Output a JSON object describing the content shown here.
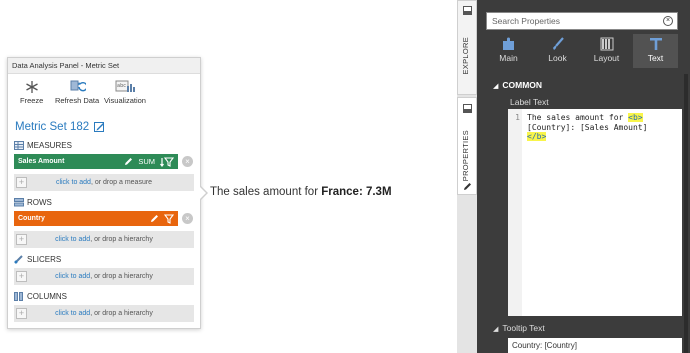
{
  "dap": {
    "title": "Data Analysis Panel - Metric Set",
    "toolbar": {
      "freeze": "Freeze",
      "refresh": "Refresh Data",
      "visualization": "Visualization"
    },
    "metric_set_title": "Metric Set 182",
    "sections": {
      "measures": "MEASURES",
      "rows": "ROWS",
      "slicers": "SLICERS",
      "columns": "COLUMNS"
    },
    "measure_field": {
      "label": "Sales Amount",
      "aggregation": "SUM",
      "color": "#2e8b57"
    },
    "row_field": {
      "label": "Country",
      "color": "#e8650e"
    },
    "drop": {
      "click_to_add": "click to add",
      "measure_rest": ", or drop a measure",
      "hierarchy_rest": ", or drop a hierarchy"
    }
  },
  "preview": {
    "prefix": "The sales amount for ",
    "bold": "France: 7.3M"
  },
  "side_tabs": {
    "explore": "EXPLORE",
    "properties": "PROPERTIES"
  },
  "properties": {
    "search_placeholder": "Search Properties",
    "tabs": [
      {
        "label": "Main",
        "icon": "puzzle-icon"
      },
      {
        "label": "Look",
        "icon": "brush-icon"
      },
      {
        "label": "Layout",
        "icon": "layout-icon"
      },
      {
        "label": "Text",
        "icon": "text-icon"
      }
    ],
    "active_tab": "Text",
    "common_header": "COMMON",
    "label_text_caption": "Label Text",
    "code": {
      "line_number": "1",
      "line1_prefix": "The sales amount for ",
      "open_tag": "<b>",
      "line2": "[Country]: [Sales Amount]",
      "close_tag": "</b>"
    },
    "tooltip_header": "Tooltip Text",
    "tooltip_value": "Country: [Country]"
  }
}
